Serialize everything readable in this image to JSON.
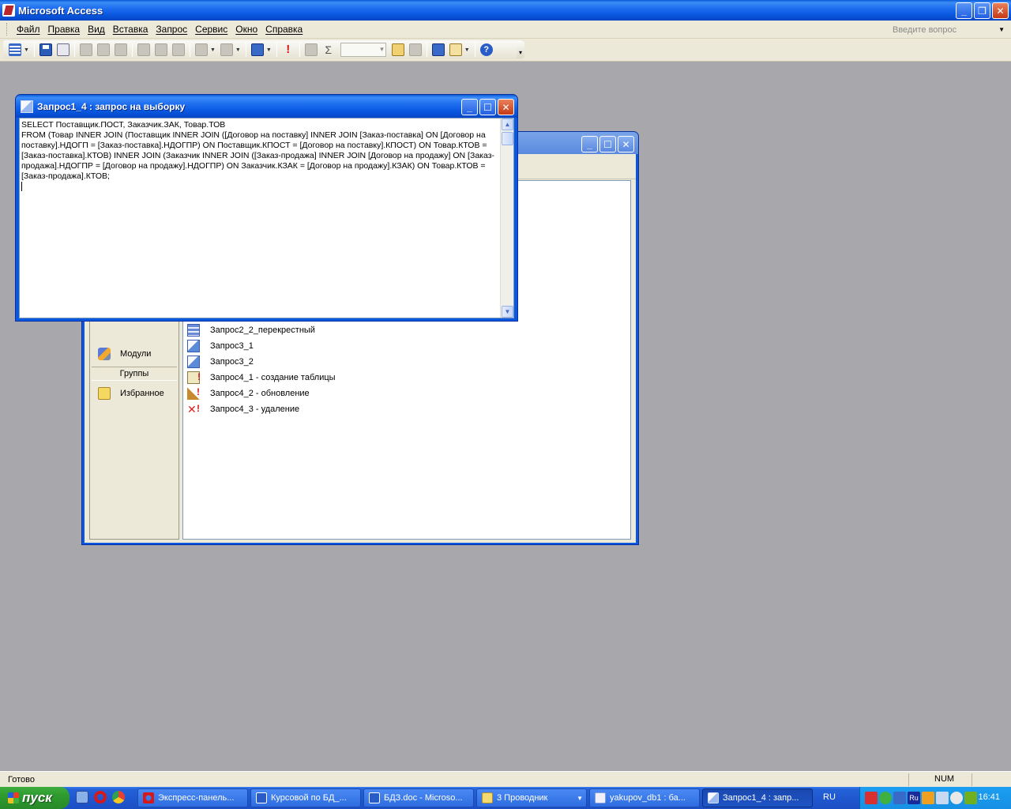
{
  "app": {
    "title": "Microsoft Access"
  },
  "menu": [
    "Файл",
    "Правка",
    "Вид",
    "Вставка",
    "Запрос",
    "Сервис",
    "Окно",
    "Справка"
  ],
  "ask_placeholder": "Введите вопрос",
  "query_window": {
    "title": "Запрос1_4 : запрос на выборку",
    "sql": "SELECT Поставщик.ПОСТ, Заказчик.ЗАК, Товар.ТОВ\nFROM (Товар INNER JOIN (Поставщик INNER JOIN ([Договор на поставку] INNER JOIN [Заказ-поставка] ON [Договор на поставку].НДОГП = [Заказ-поставка].НДОГПР) ON Поставщик.КПОСТ = [Договор на поставку].КПОСТ) ON Товар.КТОВ = [Заказ-поставка].КТОВ) INNER JOIN (Заказчик INNER JOIN ([Заказ-продажа] INNER JOIN [Договор на продажу] ON [Заказ-продажа].НДОГПР = [Договор на продажу].НДОГПР) ON Заказчик.КЗАК = [Договор на продажу].КЗАК) ON Товар.КТОВ = [Заказ-продажа].КТОВ;"
  },
  "db_window": {
    "groups": {
      "modules": "Модули",
      "groups_header": "Группы",
      "favorites": "Избранное"
    },
    "queries": [
      {
        "name": "Запрос2_2_перекрестный",
        "icon": "crosstab-query-icon"
      },
      {
        "name": "Запрос3_1",
        "icon": "select-query-icon"
      },
      {
        "name": "Запрос3_2",
        "icon": "select-query-icon"
      },
      {
        "name": "Запрос4_1 - создание таблицы",
        "icon": "make-table-query-icon"
      },
      {
        "name": "Запрос4_2 - обновление",
        "icon": "update-query-icon"
      },
      {
        "name": "Запрос4_3 - удаление",
        "icon": "delete-query-icon"
      }
    ]
  },
  "status": {
    "text": "Готово",
    "num": "NUM"
  },
  "taskbar": {
    "start": "пуск",
    "tasks": [
      {
        "label": "Экспресс-панель...",
        "icon": "opera-icon"
      },
      {
        "label": "Курсовой по БД_...",
        "icon": "word-icon"
      },
      {
        "label": "БДЗ.doc - Microso...",
        "icon": "word-icon"
      },
      {
        "label": "3 Проводник",
        "icon": "folder-icon"
      },
      {
        "label": "yakupov_db1 : ба...",
        "icon": "access-icon"
      },
      {
        "label": "Запрос1_4 : запр...",
        "icon": "query-icon"
      }
    ],
    "lang": "RU",
    "clock": "16:41"
  }
}
